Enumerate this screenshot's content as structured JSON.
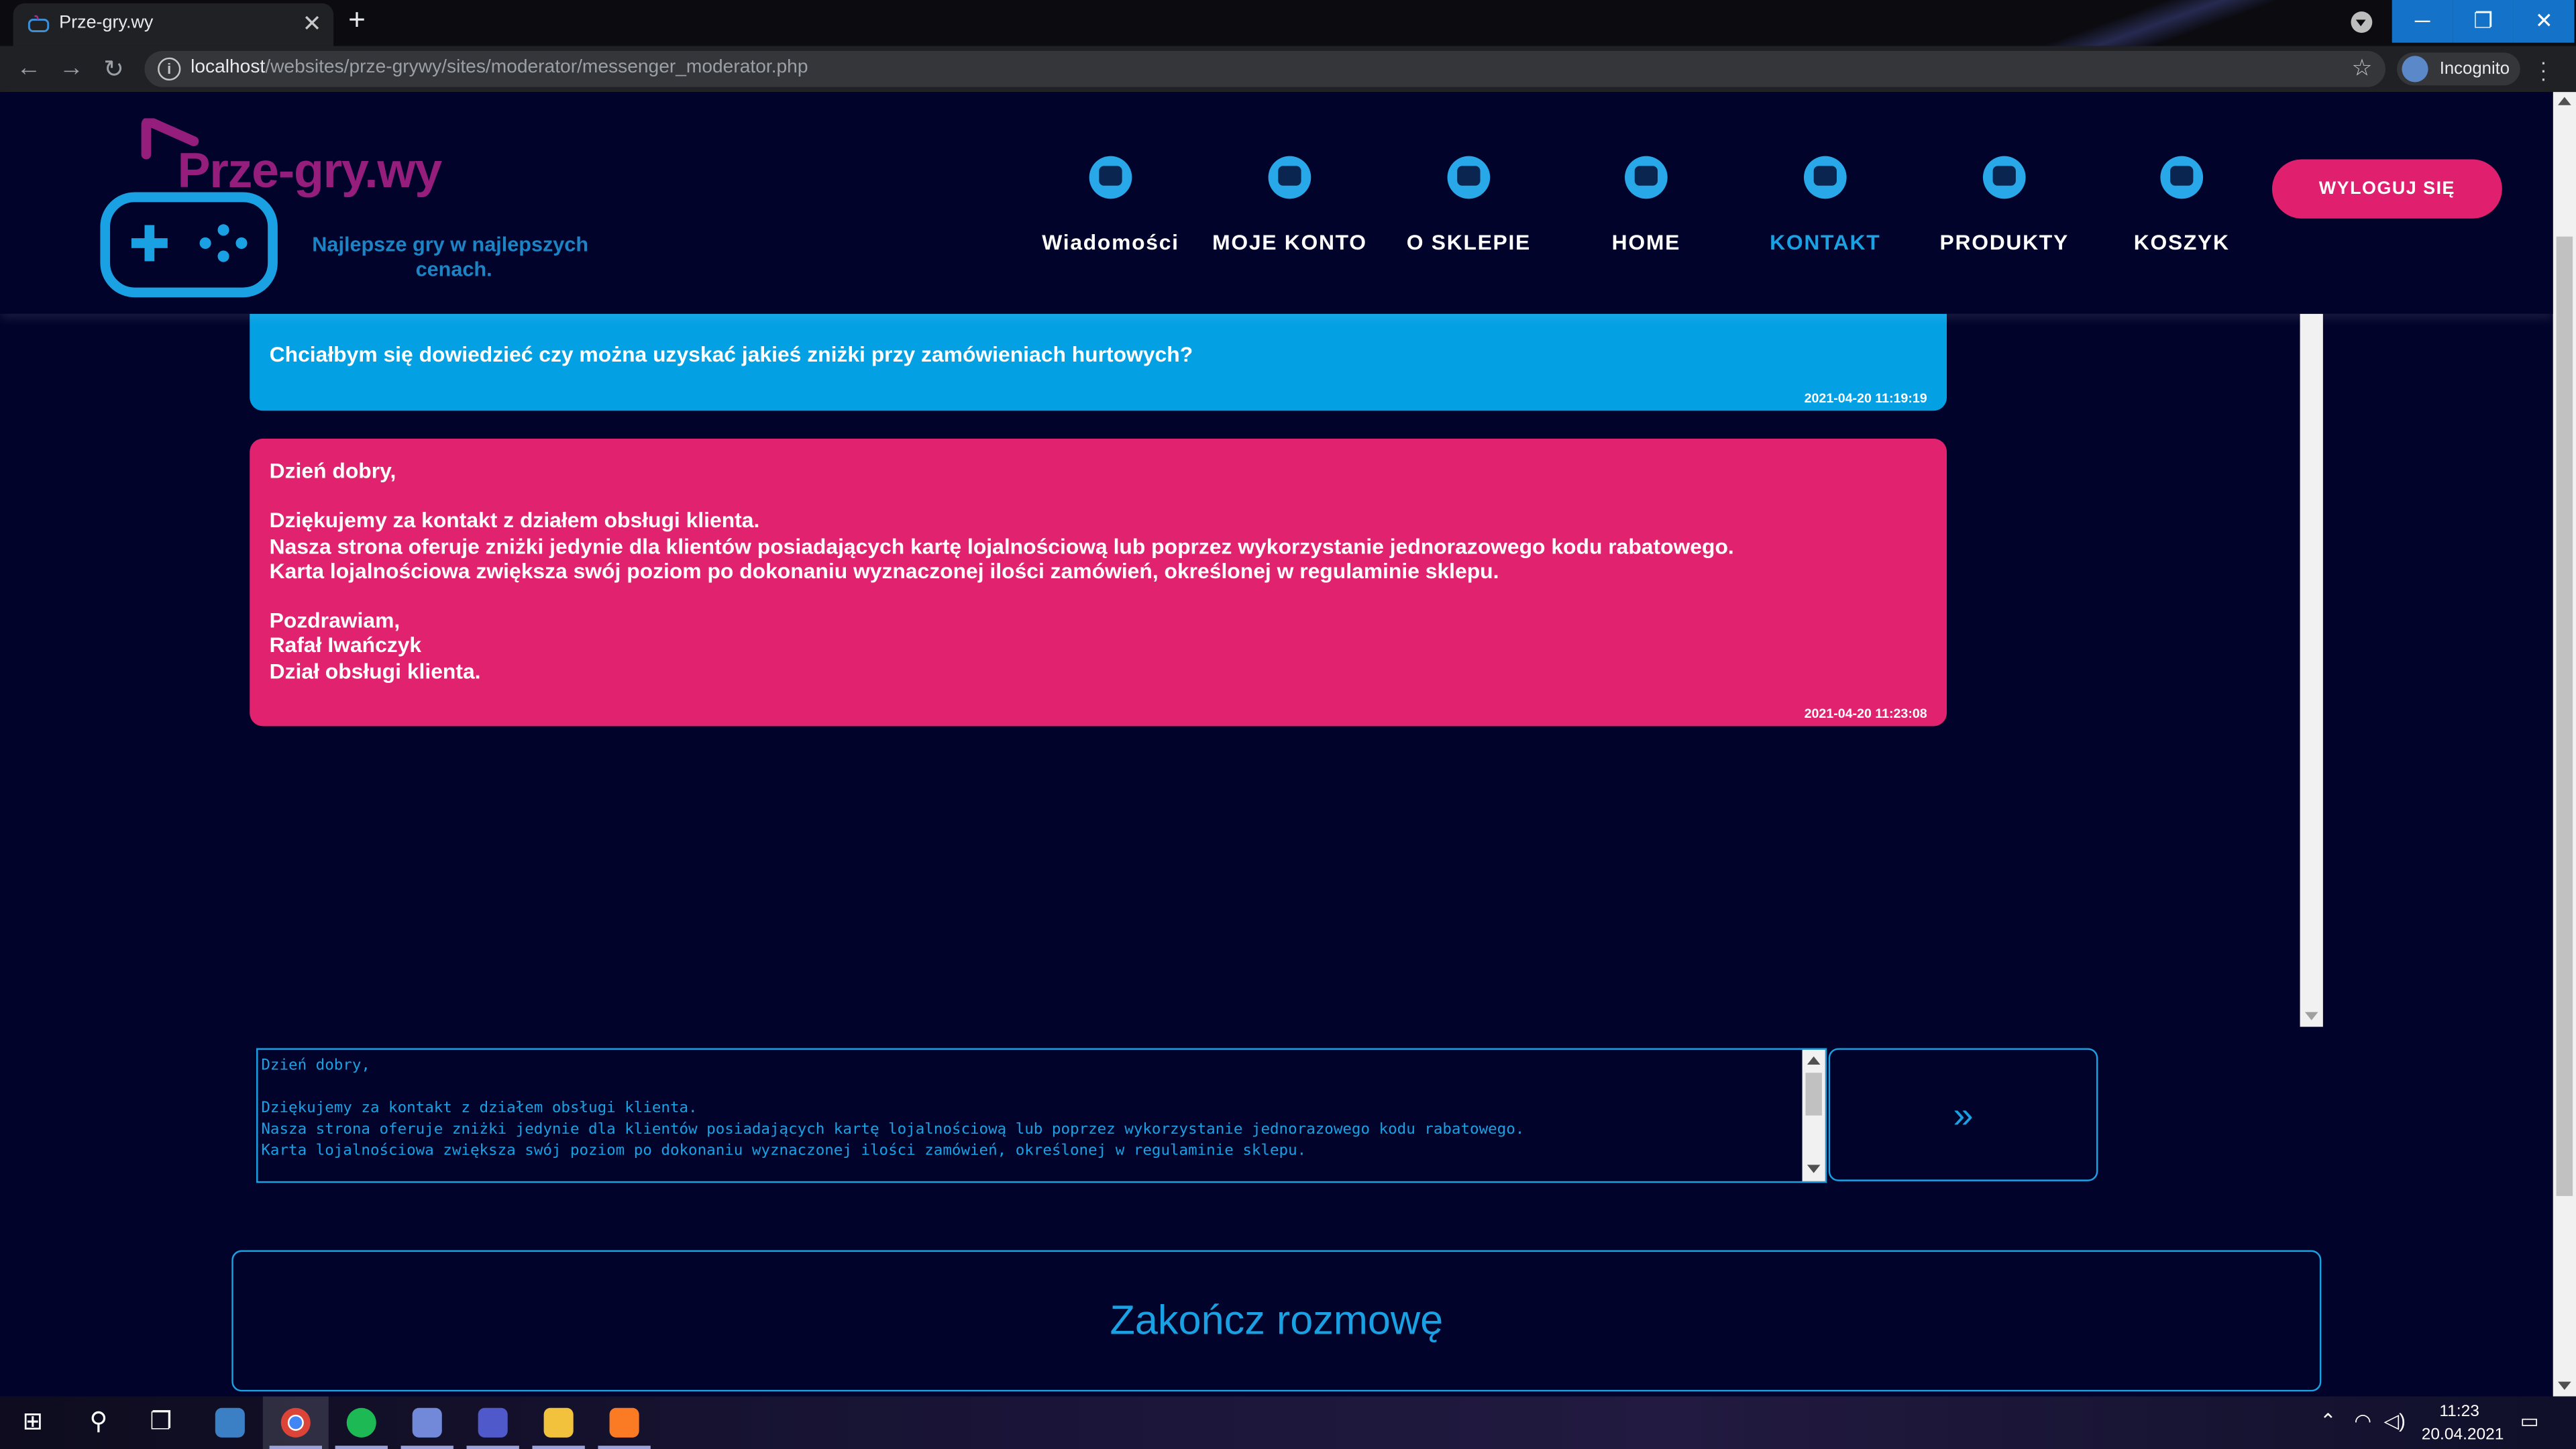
{
  "browser": {
    "tab_title": "Prze-gry.wy",
    "url_host": "localhost",
    "url_path": "/websites/prze-grywy/sites/moderator/messenger_moderator.php",
    "profile_label": "Incognito",
    "new_tab": "+",
    "close_tab": "✕",
    "window": {
      "minimize": "─",
      "maximize": "❐",
      "close": "✕"
    }
  },
  "site": {
    "logo_word": "Prze-gry.wy",
    "logo_tagline_1": "Najlepsze gry w najlepszych",
    "logo_tagline_2": "cenach.",
    "nav": [
      {
        "label": "Wiadomości",
        "icon": "message-icon"
      },
      {
        "label": "MOJE KONTO",
        "icon": "account-icon"
      },
      {
        "label": "O SKLEPIE",
        "icon": "about-icon"
      },
      {
        "label": "HOME",
        "icon": "home-icon"
      },
      {
        "label": "KONTAKT",
        "icon": "contact-icon",
        "active": true
      },
      {
        "label": "PRODUKTY",
        "icon": "gamepad-icon"
      },
      {
        "label": "KOSZYK",
        "icon": "cart-icon"
      }
    ],
    "logout_label": "WYLOGUJ SIĘ"
  },
  "chat": {
    "messages": [
      {
        "role": "user",
        "text": "Chciałbym się dowiedzieć czy można uzyskać jakieś zniżki przy zamówieniach hurtowych?",
        "timestamp": "2021-04-20 11:19:19"
      },
      {
        "role": "moderator",
        "text": "Dzień dobry,\n\nDziękujemy za kontakt z działem obsługi klienta.\nNasza strona oferuje zniżki jedynie dla klientów posiadających kartę lojalnościową lub poprzez wykorzystanie jednorazowego kodu rabatowego.\nKarta lojalnościowa zwiększa swój poziom po dokonaniu wyznaczonej ilości zamówień, określonej w regulaminie sklepu.\n\nPozdrawiam,\nRafał Iwańczyk\nDział obsługi klienta.",
        "timestamp": "2021-04-20 11:23:08"
      }
    ],
    "composer_value": "Dzień dobry,\n\nDziękujemy za kontakt z działem obsługi klienta.\nNasza strona oferuje zniżki jedynie dla klientów posiadających kartę lojalnościową lub poprzez wykorzystanie jednorazowego kodu rabatowego.\nKarta lojalnościowa zwiększa swój poziom po dokonaniu wyznaczonej ilości zamówień, określonej w regulaminie sklepu.",
    "send_label": "»",
    "end_label": "Zakończ rozmowę"
  },
  "colors": {
    "page_bg": "#02032a",
    "accent_blue": "#1aa1e3",
    "user_bubble": "#03a0e4",
    "moderator_bubble": "#e0226f",
    "logout_button": "#e0206f",
    "logo_purple": "#951e7d"
  },
  "taskbar": {
    "time": "11:23",
    "date": "20.04.2021",
    "apps": [
      "windows-start-icon",
      "search-icon",
      "task-view-icon",
      "unknown-app-icon",
      "chrome-icon",
      "spotify-icon",
      "discord-icon",
      "teams-icon",
      "file-explorer-icon",
      "xampp-icon"
    ]
  }
}
